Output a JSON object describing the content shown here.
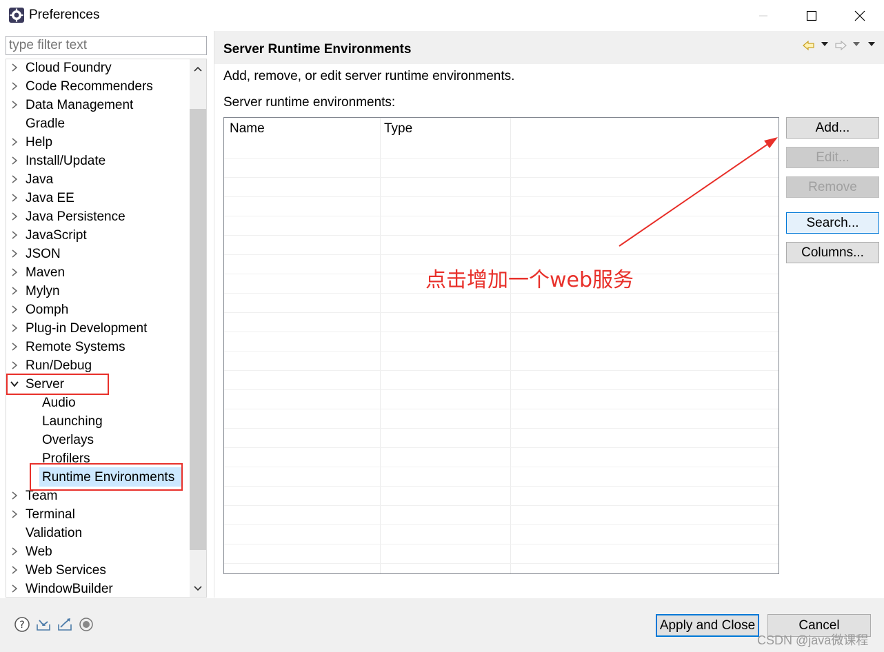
{
  "window": {
    "title": "Preferences",
    "icon": "eclipse-gear-icon"
  },
  "filter": {
    "placeholder": "type filter text",
    "value": ""
  },
  "tree": {
    "items": [
      {
        "label": "Cloud Foundry",
        "expandable": true
      },
      {
        "label": "Code Recommenders",
        "expandable": true
      },
      {
        "label": "Data Management",
        "expandable": true
      },
      {
        "label": "Gradle",
        "expandable": false
      },
      {
        "label": "Help",
        "expandable": true
      },
      {
        "label": "Install/Update",
        "expandable": true
      },
      {
        "label": "Java",
        "expandable": true
      },
      {
        "label": "Java EE",
        "expandable": true
      },
      {
        "label": "Java Persistence",
        "expandable": true
      },
      {
        "label": "JavaScript",
        "expandable": true
      },
      {
        "label": "JSON",
        "expandable": true
      },
      {
        "label": "Maven",
        "expandable": true
      },
      {
        "label": "Mylyn",
        "expandable": true
      },
      {
        "label": "Oomph",
        "expandable": true
      },
      {
        "label": "Plug-in Development",
        "expandable": true
      },
      {
        "label": "Remote Systems",
        "expandable": true
      },
      {
        "label": "Run/Debug",
        "expandable": true
      },
      {
        "label": "Server",
        "expandable": true,
        "expanded": true
      },
      {
        "label": "Audio",
        "child": true
      },
      {
        "label": "Launching",
        "child": true
      },
      {
        "label": "Overlays",
        "child": true
      },
      {
        "label": "Profilers",
        "child": true
      },
      {
        "label": "Runtime Environments",
        "child": true,
        "selected": true
      },
      {
        "label": "Team",
        "expandable": true
      },
      {
        "label": "Terminal",
        "expandable": true
      },
      {
        "label": "Validation",
        "expandable": false
      },
      {
        "label": "Web",
        "expandable": true
      },
      {
        "label": "Web Services",
        "expandable": true
      },
      {
        "label": "WindowBuilder",
        "expandable": true
      }
    ]
  },
  "page": {
    "title": "Server Runtime Environments",
    "description": "Add, remove, or edit server runtime environments.",
    "list_label": "Server runtime environments:"
  },
  "table": {
    "columns": [
      "Name",
      "Type"
    ],
    "rows": []
  },
  "buttons": {
    "add": "Add...",
    "edit": "Edit...",
    "remove": "Remove",
    "search": "Search...",
    "columns": "Columns..."
  },
  "annotation": {
    "text": "点击增加一个web服务",
    "color": "#e8302a"
  },
  "footer": {
    "apply_close": "Apply and Close",
    "cancel": "Cancel",
    "icons": [
      "help-icon",
      "import-icon",
      "export-icon",
      "oomph-record-icon"
    ]
  },
  "watermark": "CSDN @java微课程",
  "colors": {
    "selection": "#cce8ff",
    "focus_border": "#0078d7",
    "annotation_red": "#e8302a"
  }
}
